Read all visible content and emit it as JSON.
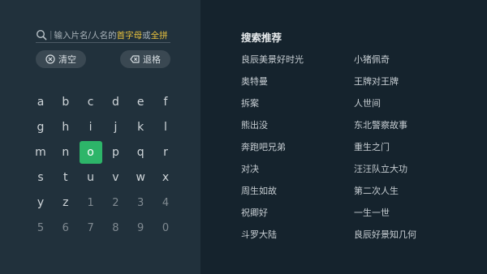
{
  "search": {
    "prompt_prefix": "输入片名/人名的",
    "prompt_highlight1": "首字母",
    "prompt_mid": "或",
    "prompt_highlight2": "全拼"
  },
  "actions": {
    "clear_label": "清空",
    "backspace_label": "退格"
  },
  "keyboard": {
    "rows": [
      [
        "a",
        "b",
        "c",
        "d",
        "e",
        "f"
      ],
      [
        "g",
        "h",
        "i",
        "j",
        "k",
        "l"
      ],
      [
        "m",
        "n",
        "o",
        "p",
        "q",
        "r"
      ],
      [
        "s",
        "t",
        "u",
        "v",
        "w",
        "x"
      ],
      [
        "y",
        "z",
        "1",
        "2",
        "3",
        "4"
      ],
      [
        "5",
        "6",
        "7",
        "8",
        "9",
        "0"
      ]
    ],
    "selected": "o"
  },
  "recommendations": {
    "title": "搜索推荐",
    "left": [
      "良辰美景好时光",
      "奥特曼",
      "拆案",
      "熊出没",
      "奔跑吧兄弟",
      "对决",
      "周生如故",
      "祝卿好",
      "斗罗大陆"
    ],
    "right": [
      "小猪佩奇",
      "王牌对王牌",
      "人世间",
      "东北警察故事",
      "重生之门",
      "汪汪队立大功",
      "第二次人生",
      "一生一世",
      "良辰好景知几何"
    ]
  },
  "colors": {
    "left_panel": "#21313c",
    "right_panel": "#15232d",
    "accent_selected": "#2db569",
    "highlight_text": "#e9c23e"
  },
  "icons": {
    "search": "search-icon",
    "clear": "clear-x-circle-icon",
    "backspace": "backspace-icon"
  }
}
